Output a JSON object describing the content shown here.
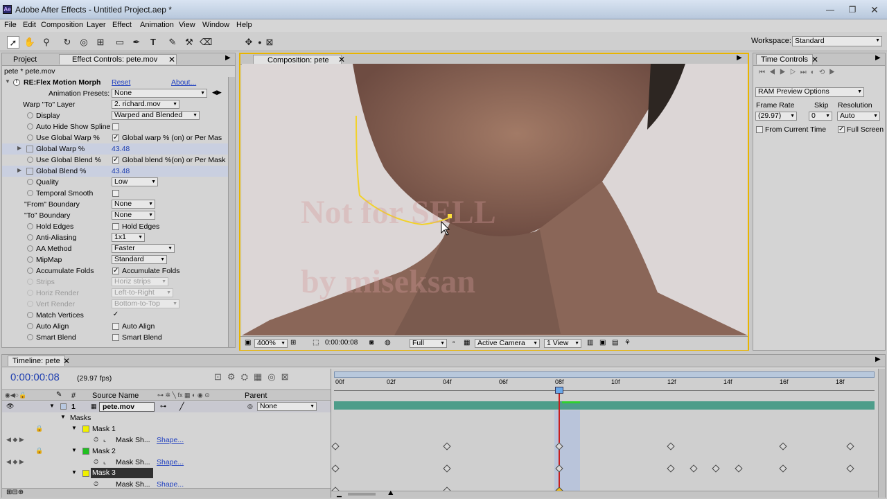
{
  "app": {
    "title": "Adobe After Effects - Untitled Project.aep *",
    "icon": "after-effects-logo-icon"
  },
  "menu": [
    "File",
    "Edit",
    "Composition",
    "Layer",
    "Effect",
    "Animation",
    "View",
    "Window",
    "Help"
  ],
  "workspace": {
    "label": "Workspace:",
    "value": "Standard"
  },
  "project_panel": {
    "tab_project": "Project",
    "tab_effect": "Effect Controls: pete.mov",
    "breadcrumb": "pete * pete.mov"
  },
  "effect": {
    "name": "RE:Flex Motion Morph",
    "reset": "Reset",
    "about": "About...",
    "presets_label": "Animation Presets:",
    "presets_value": "None",
    "rows": [
      {
        "label": "Warp \"To\" Layer",
        "value": "2. richard.mov"
      },
      {
        "label": "Display",
        "value": "Warped and Blended"
      },
      {
        "label": "Auto Hide Show Spline"
      },
      {
        "label": "Use Global Warp %",
        "value": "Global warp % (on) or Per Mas"
      },
      {
        "label": "Global Warp %",
        "value": "43.48"
      },
      {
        "label": "Use Global Blend %",
        "value": "Global blend %(on) or Per Mask"
      },
      {
        "label": "Global Blend %",
        "value": "43.48"
      },
      {
        "label": "Quality",
        "value": "Low"
      },
      {
        "label": "Temporal Smooth"
      },
      {
        "label": "\"From\" Boundary",
        "value": "None"
      },
      {
        "label": "\"To\" Boundary",
        "value": "None"
      },
      {
        "label": "Hold Edges",
        "value": "Hold Edges"
      },
      {
        "label": "Anti-Aliasing",
        "value": "1x1"
      },
      {
        "label": "AA Method",
        "value": "Faster"
      },
      {
        "label": "MipMap",
        "value": "Standard"
      },
      {
        "label": "Accumulate Folds",
        "value": "Accumulate Folds"
      },
      {
        "label": "Strips",
        "value": "Horiz strips"
      },
      {
        "label": "Horiz Render",
        "value": "Left-to-Right"
      },
      {
        "label": "Vert Render",
        "value": "Bottom-to-Top"
      },
      {
        "label": "Match Vertices"
      },
      {
        "label": "Auto Align",
        "value": "Auto Align"
      },
      {
        "label": "Smart Blend",
        "value": "Smart Blend"
      }
    ]
  },
  "composition": {
    "tab": "Composition: pete",
    "watermark_line1": "Not for SELL",
    "watermark_line2": "by miseksan",
    "footer": {
      "zoom": "400%",
      "timecode": "0:00:00:08",
      "resolution": "Full",
      "camera": "Active Camera",
      "views": "1 View"
    }
  },
  "time_controls": {
    "tab": "Time Controls",
    "ram_preview": "RAM Preview Options",
    "frame_rate_label": "Frame Rate",
    "frame_rate_value": "(29.97)",
    "skip_label": "Skip",
    "skip_value": "0",
    "resolution_label": "Resolution",
    "resolution_value": "Auto",
    "from_current": "From Current Time",
    "full_screen": "Full Screen"
  },
  "timeline": {
    "tab": "Timeline: pete",
    "timecode": "0:00:00:08",
    "fps": "(29.97 fps)",
    "col_number": "#",
    "col_source": "Source Name",
    "col_parent": "Parent",
    "layer": {
      "number": "1",
      "name": "pete.mov",
      "parent": "None"
    },
    "masks_label": "Masks",
    "mask1": "Mask 1",
    "mask2": "Mask 2",
    "mask3": "Mask 3",
    "mask_shape": "Mask Sh...",
    "shape_link": "Shape...",
    "ruler": [
      "00f",
      "02f",
      "04f",
      "06f",
      "08f",
      "10f",
      "12f",
      "14f",
      "16f",
      "18f"
    ]
  }
}
